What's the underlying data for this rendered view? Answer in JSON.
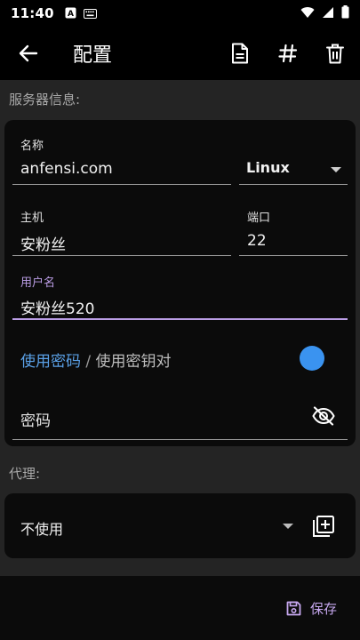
{
  "status_bar": {
    "time": "11:40",
    "icons": [
      "a-icon",
      "keyboard-icon",
      "wifi-icon",
      "signal-icon",
      "battery-icon"
    ]
  },
  "app_bar": {
    "title": "配置",
    "actions": [
      "document-icon",
      "hash-icon",
      "delete-icon"
    ]
  },
  "server_section": {
    "label": "服务器信息:",
    "name_label": "名称",
    "name_value": "anfensi.com",
    "os_value": "Linux",
    "host_label": "主机",
    "host_value": "安粉丝",
    "port_label": "端口",
    "port_value": "22",
    "username_label": "用户名",
    "username_value": "安粉丝520",
    "auth_option_password": "使用密码",
    "auth_separator": " / ",
    "auth_option_key": "使用密钥对",
    "password_placeholder": "密码"
  },
  "proxy_section": {
    "label": "代理:",
    "value": "不使用"
  },
  "bottom": {
    "save_label": "保存"
  },
  "colors": {
    "accent": "#bb9ee6",
    "toggle": "#3a93f0",
    "link": "#5aa0e6"
  }
}
